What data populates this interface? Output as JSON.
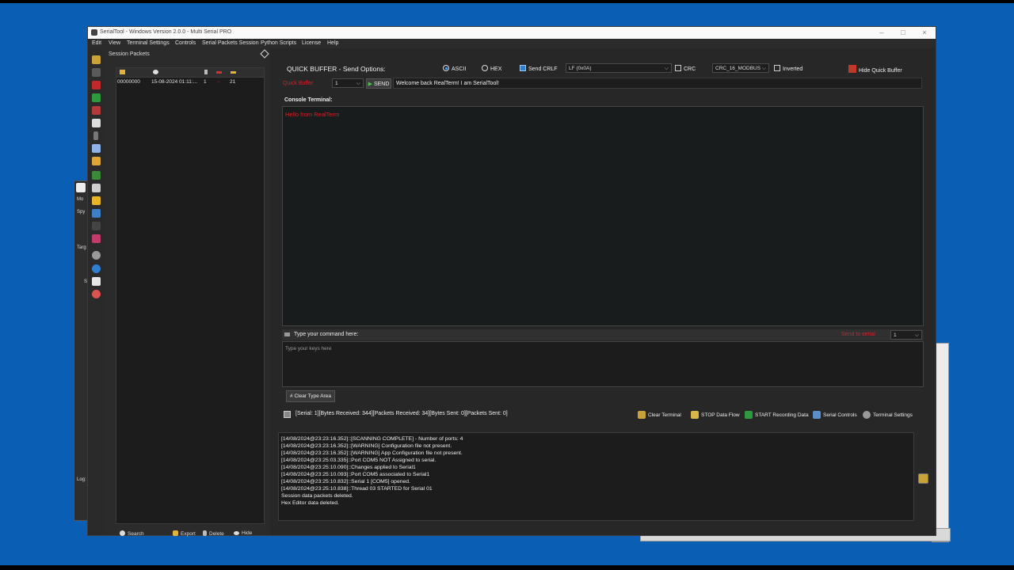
{
  "window": {
    "title": "SerialTool - Windows Version 2.0.0 - Multi Serial PRO"
  },
  "menu": [
    "Edit",
    "View",
    "Terminal Settings",
    "Controls",
    "Serial Packets Session",
    "Python Scripts",
    "License",
    "Help"
  ],
  "session_panel": {
    "title": "Session Packets",
    "rows": [
      {
        "id": "00000000",
        "time": "15-08-2024 01:11:...",
        "dir": "1",
        "len": "21"
      }
    ],
    "buttons": {
      "search": "Search",
      "export": "Export",
      "delete": "Delete",
      "hide": "Hide"
    }
  },
  "quick_buffer": {
    "title": "QUICK BUFFER - Send Options:",
    "ascii": "ASCII",
    "hex": "HEX",
    "send_crlf": "Send CRLF",
    "line_ending": "LF (0x0A)",
    "crc": "CRC",
    "crc_type": "CRC_16_MODBUS",
    "inverted": "Inverted",
    "hide": "Hide Quick Buffer",
    "red_label": "Quick Buffer",
    "serial_select": "1",
    "send": "SEND",
    "message": "Welcome back RealTerm! I am SerialTool!"
  },
  "console": {
    "label": "Console Terminal:",
    "text": "Hello from RealTerm"
  },
  "command": {
    "label": "Type your command here:",
    "red_label": "Send to serial",
    "serial_select": "1",
    "placeholder": "Type your keys here",
    "clear": "Clear Type Area"
  },
  "status": {
    "text": "[Serial: 1][Bytes Received: 344][Packets Received: 34][Bytes Sent: 0][Packets Sent: 0]",
    "buttons": {
      "clear_terminal": "Clear Terminal",
      "stop_flow": "STOP Data Flow",
      "start_record": "START Recording Data",
      "serial_controls": "Serial Controls",
      "terminal_settings": "Terminal Settings"
    }
  },
  "log": [
    "[14/08/2024@23:23:16.352]::[SCANNING COMPLETE] - Number of ports: 4",
    "[14/08/2024@23:23:16.352]::[WARNING] Configuration file not present.",
    "[14/08/2024@23:23:16.352]::[WARNING] App Configuration file not present.",
    "[14/08/2024@23:25:03.335]::Port COM5 NOT Assigned to serial.",
    "[14/08/2024@23:25:10.090]::Changes applied to Serial1",
    "[14/08/2024@23:25:10.093]::Port COM5 associated to Serial1",
    "[14/08/2024@23:25:10.832]::Serial 1 [COM5] opened.",
    "[14/08/2024@23:25:10.838]::Thread 03 STARTED for Serial 01",
    "Session data packets deleted.",
    "Hex Editor data deleted."
  ],
  "bg_left": [
    "Mo",
    "Spy",
    "Targ",
    "S",
    "Log:"
  ],
  "colors": {
    "accent_red": "#d1222a",
    "desktop": "#0a5fb4",
    "panel": "#272727"
  }
}
